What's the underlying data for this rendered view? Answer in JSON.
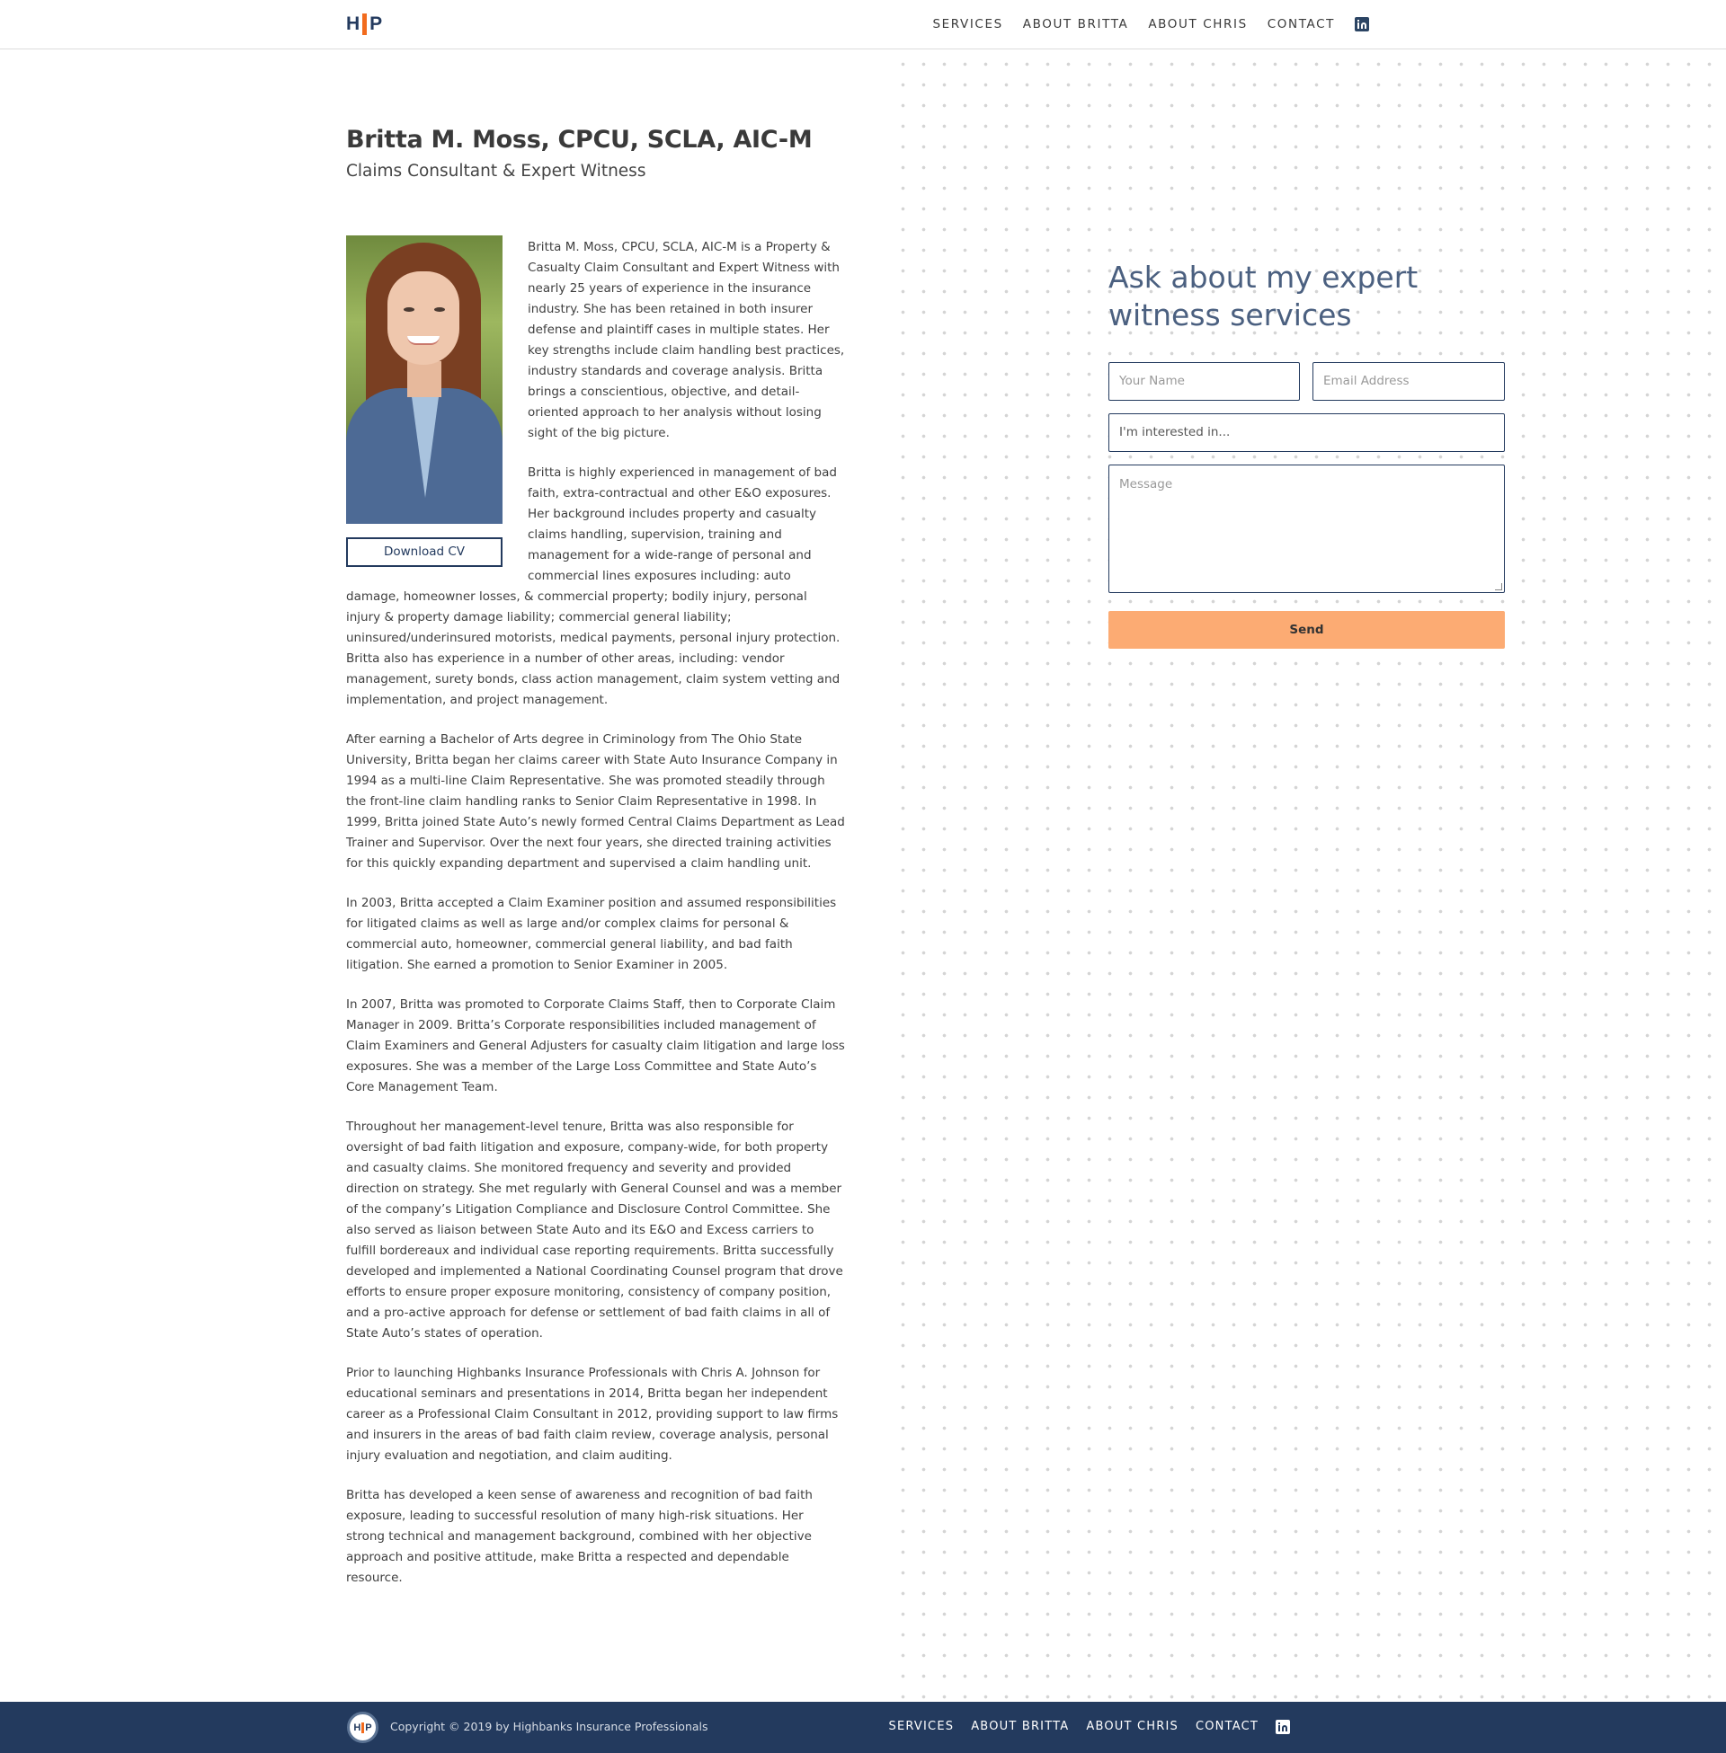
{
  "header": {
    "logo": {
      "left": "H",
      "right": "P"
    },
    "nav": [
      "SERVICES",
      "ABOUT BRITTA",
      "ABOUT CHRIS",
      "CONTACT"
    ]
  },
  "profile": {
    "name": "Britta M. Moss, CPCU, SCLA, AIC-M",
    "subtitle": "Claims Consultant & Expert Witness",
    "cv_button": "Download CV",
    "bio": [
      "Britta M. Moss, CPCU, SCLA, AIC-M is a Property & Casualty Claim Consultant and Expert Witness with nearly 25 years of experience in the insurance industry. She has been retained in both insurer defense and plaintiff cases in multiple states. Her key strengths include claim handling best practices, industry standards and coverage analysis. Britta brings a conscientious, objective, and detail-oriented approach to her analysis without losing sight of the big picture.",
      "Britta is highly experienced in management of bad faith, extra-contractual and other E&O exposures. Her background includes property and casualty claims handling, supervision, training and management for a wide-range of personal and commercial lines exposures including: auto damage, homeowner losses, & commercial property; bodily injury, personal injury & property damage liability; commercial general liability; uninsured/underinsured motorists, medical payments, personal injury protection. Britta also has experience in a number of other areas, including: vendor management, surety bonds, class action management, claim system vetting and implementation, and project management.",
      "After earning a Bachelor of Arts degree in Criminology from The Ohio State University, Britta began her claims career with State Auto Insurance Company in 1994 as a multi-line Claim Representative. She was promoted steadily through the front-line claim handling ranks to Senior Claim Representative in 1998. In 1999, Britta joined State Auto’s newly formed Central Claims Department as Lead Trainer and Supervisor. Over the next four years, she directed training activities for this quickly expanding department and supervised a claim handling unit.",
      "In 2003, Britta accepted a Claim Examiner position and assumed responsibilities for litigated claims as well as large and/or complex claims for personal & commercial auto, homeowner, commercial general liability, and bad faith litigation. She earned a promotion to Senior Examiner in 2005.",
      "In 2007, Britta was promoted to Corporate Claims Staff, then to Corporate Claim Manager in 2009. Britta’s Corporate responsibilities included management of Claim Examiners and General Adjusters for casualty claim litigation and large loss exposures. She was a member of the Large Loss Committee and State Auto’s Core Management Team.",
      "Throughout her management-level tenure, Britta was also responsible for oversight of bad faith litigation and exposure, company-wide, for both property and casualty claims. She monitored frequency and severity and provided direction on strategy. She met regularly with General Counsel and was a member of the company’s Litigation Compliance and Disclosure Control Committee. She also served as liaison between State Auto and its E&O and Excess carriers to fulfill bordereaux and individual case reporting requirements. Britta successfully developed and implemented a National Coordinating Counsel program that drove efforts to ensure proper exposure monitoring, consistency of company position, and a pro-active approach for defense or settlement of bad faith claims in all of State Auto’s states of operation.",
      "Prior to launching Highbanks Insurance Professionals with Chris A. Johnson for educational seminars and presentations in 2014, Britta began her independent career as a Professional Claim Consultant in 2012, providing support to law firms and insurers in the areas of bad faith claim review, coverage analysis, personal injury evaluation and negotiation, and claim auditing.",
      "Britta has developed a keen sense of awareness and recognition of bad faith exposure, leading to successful resolution of many high-risk situations. Her strong technical and management background, combined with her objective approach and positive attitude, make Britta a respected and dependable resource."
    ]
  },
  "contact_form": {
    "title": "Ask about my expert witness services",
    "name_placeholder": "Your Name",
    "email_placeholder": "Email Address",
    "interest_value": "I'm interested in...",
    "message_placeholder": "Message",
    "send_label": "Send"
  },
  "footer": {
    "logo": {
      "left": "H",
      "right": "P"
    },
    "copyright": "Copyright © 2019 by Highbanks Insurance Professionals",
    "nav": [
      "SERVICES",
      "ABOUT BRITTA",
      "ABOUT CHRIS",
      "CONTACT"
    ]
  },
  "colors": {
    "navy": "#233a5e",
    "accent_orange": "#f26b1d",
    "send_button": "#fcab73",
    "title_blue": "#4b6080"
  },
  "icons": {
    "social": "linkedin-icon"
  }
}
